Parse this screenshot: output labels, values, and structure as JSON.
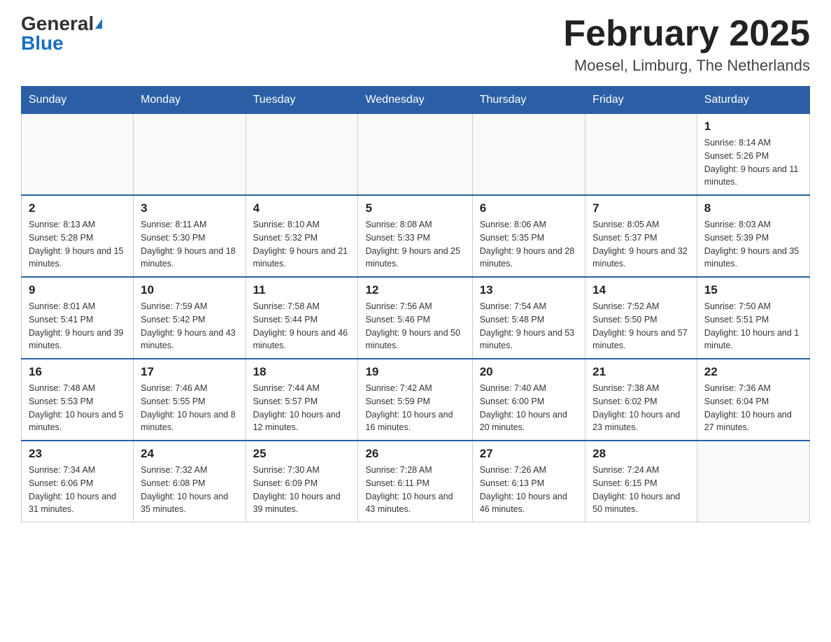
{
  "header": {
    "logo_general": "General",
    "logo_blue": "Blue",
    "title": "February 2025",
    "subtitle": "Moesel, Limburg, The Netherlands"
  },
  "days_of_week": [
    "Sunday",
    "Monday",
    "Tuesday",
    "Wednesday",
    "Thursday",
    "Friday",
    "Saturday"
  ],
  "weeks": [
    {
      "days": [
        {
          "number": "",
          "info": ""
        },
        {
          "number": "",
          "info": ""
        },
        {
          "number": "",
          "info": ""
        },
        {
          "number": "",
          "info": ""
        },
        {
          "number": "",
          "info": ""
        },
        {
          "number": "",
          "info": ""
        },
        {
          "number": "1",
          "info": "Sunrise: 8:14 AM\nSunset: 5:26 PM\nDaylight: 9 hours and 11 minutes."
        }
      ]
    },
    {
      "days": [
        {
          "number": "2",
          "info": "Sunrise: 8:13 AM\nSunset: 5:28 PM\nDaylight: 9 hours and 15 minutes."
        },
        {
          "number": "3",
          "info": "Sunrise: 8:11 AM\nSunset: 5:30 PM\nDaylight: 9 hours and 18 minutes."
        },
        {
          "number": "4",
          "info": "Sunrise: 8:10 AM\nSunset: 5:32 PM\nDaylight: 9 hours and 21 minutes."
        },
        {
          "number": "5",
          "info": "Sunrise: 8:08 AM\nSunset: 5:33 PM\nDaylight: 9 hours and 25 minutes."
        },
        {
          "number": "6",
          "info": "Sunrise: 8:06 AM\nSunset: 5:35 PM\nDaylight: 9 hours and 28 minutes."
        },
        {
          "number": "7",
          "info": "Sunrise: 8:05 AM\nSunset: 5:37 PM\nDaylight: 9 hours and 32 minutes."
        },
        {
          "number": "8",
          "info": "Sunrise: 8:03 AM\nSunset: 5:39 PM\nDaylight: 9 hours and 35 minutes."
        }
      ]
    },
    {
      "days": [
        {
          "number": "9",
          "info": "Sunrise: 8:01 AM\nSunset: 5:41 PM\nDaylight: 9 hours and 39 minutes."
        },
        {
          "number": "10",
          "info": "Sunrise: 7:59 AM\nSunset: 5:42 PM\nDaylight: 9 hours and 43 minutes."
        },
        {
          "number": "11",
          "info": "Sunrise: 7:58 AM\nSunset: 5:44 PM\nDaylight: 9 hours and 46 minutes."
        },
        {
          "number": "12",
          "info": "Sunrise: 7:56 AM\nSunset: 5:46 PM\nDaylight: 9 hours and 50 minutes."
        },
        {
          "number": "13",
          "info": "Sunrise: 7:54 AM\nSunset: 5:48 PM\nDaylight: 9 hours and 53 minutes."
        },
        {
          "number": "14",
          "info": "Sunrise: 7:52 AM\nSunset: 5:50 PM\nDaylight: 9 hours and 57 minutes."
        },
        {
          "number": "15",
          "info": "Sunrise: 7:50 AM\nSunset: 5:51 PM\nDaylight: 10 hours and 1 minute."
        }
      ]
    },
    {
      "days": [
        {
          "number": "16",
          "info": "Sunrise: 7:48 AM\nSunset: 5:53 PM\nDaylight: 10 hours and 5 minutes."
        },
        {
          "number": "17",
          "info": "Sunrise: 7:46 AM\nSunset: 5:55 PM\nDaylight: 10 hours and 8 minutes."
        },
        {
          "number": "18",
          "info": "Sunrise: 7:44 AM\nSunset: 5:57 PM\nDaylight: 10 hours and 12 minutes."
        },
        {
          "number": "19",
          "info": "Sunrise: 7:42 AM\nSunset: 5:59 PM\nDaylight: 10 hours and 16 minutes."
        },
        {
          "number": "20",
          "info": "Sunrise: 7:40 AM\nSunset: 6:00 PM\nDaylight: 10 hours and 20 minutes."
        },
        {
          "number": "21",
          "info": "Sunrise: 7:38 AM\nSunset: 6:02 PM\nDaylight: 10 hours and 23 minutes."
        },
        {
          "number": "22",
          "info": "Sunrise: 7:36 AM\nSunset: 6:04 PM\nDaylight: 10 hours and 27 minutes."
        }
      ]
    },
    {
      "days": [
        {
          "number": "23",
          "info": "Sunrise: 7:34 AM\nSunset: 6:06 PM\nDaylight: 10 hours and 31 minutes."
        },
        {
          "number": "24",
          "info": "Sunrise: 7:32 AM\nSunset: 6:08 PM\nDaylight: 10 hours and 35 minutes."
        },
        {
          "number": "25",
          "info": "Sunrise: 7:30 AM\nSunset: 6:09 PM\nDaylight: 10 hours and 39 minutes."
        },
        {
          "number": "26",
          "info": "Sunrise: 7:28 AM\nSunset: 6:11 PM\nDaylight: 10 hours and 43 minutes."
        },
        {
          "number": "27",
          "info": "Sunrise: 7:26 AM\nSunset: 6:13 PM\nDaylight: 10 hours and 46 minutes."
        },
        {
          "number": "28",
          "info": "Sunrise: 7:24 AM\nSunset: 6:15 PM\nDaylight: 10 hours and 50 minutes."
        },
        {
          "number": "",
          "info": ""
        }
      ]
    }
  ]
}
